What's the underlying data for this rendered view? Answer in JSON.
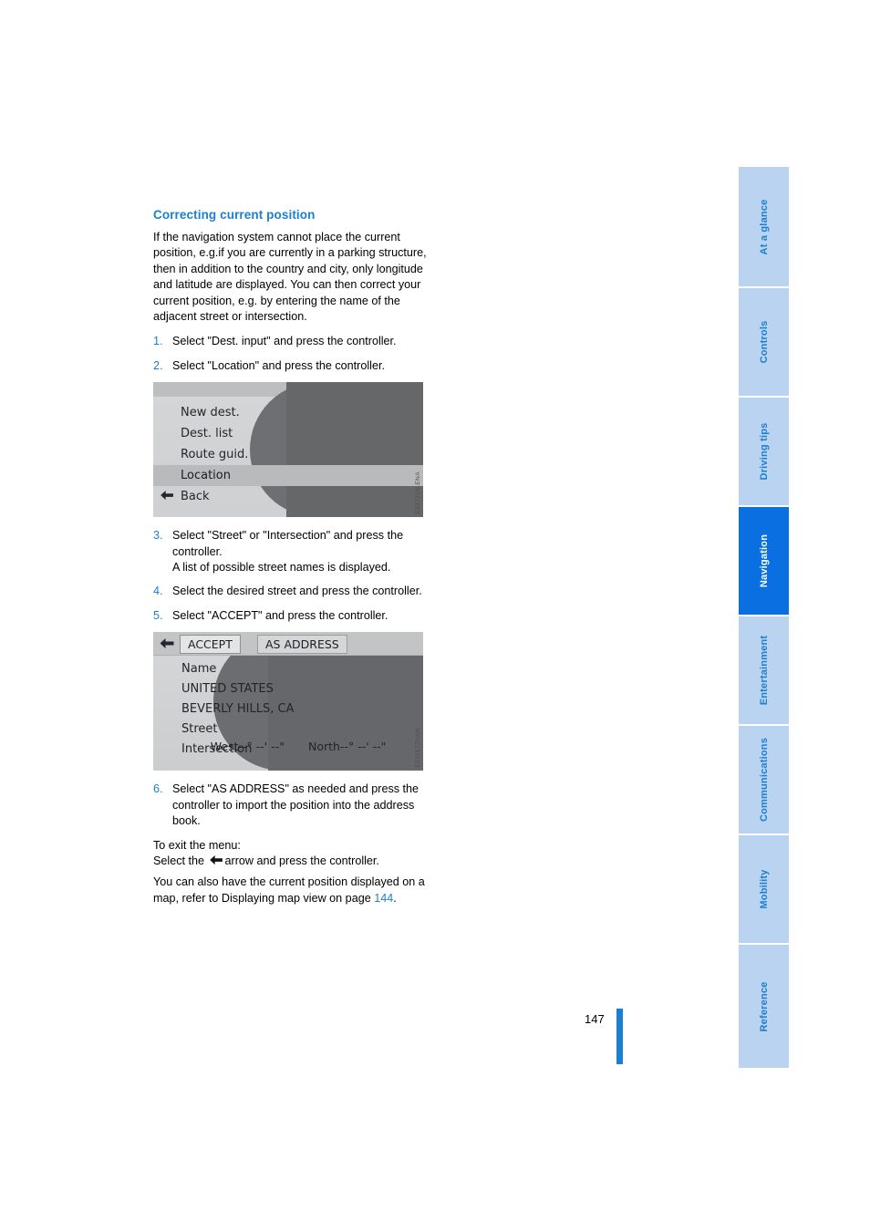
{
  "document": {
    "page_number": "147"
  },
  "main": {
    "heading": "Correcting current position",
    "intro": "If the navigation system cannot place the current position, e.g.if you are currently in a parking structure, then in addition to the country and city, only longitude and latitude are displayed. You can then correct your current position, e.g. by entering the name of the adjacent street or intersection.",
    "steps": [
      {
        "num": "1.",
        "text": "Select \"Dest. input\" and press the controller."
      },
      {
        "num": "2.",
        "text": "Select \"Location\" and press the controller."
      },
      {
        "num": "3.",
        "text": "Select \"Street\" or \"Intersection\" and press the controller.\nA list of possible street names is displayed."
      },
      {
        "num": "4.",
        "text": "Select the desired street and press the controller."
      },
      {
        "num": "5.",
        "text": "Select \"ACCEPT\" and press the controller."
      },
      {
        "num": "6.",
        "text": "Select \"AS ADDRESS\" as needed and press the controller to import the position into the address book."
      }
    ],
    "exit_label": "To exit the menu:",
    "exit_text_before": "Select the",
    "exit_text_after": "arrow and press the controller.",
    "closing_before": "You can also have the current position displayed on a map, refer to Displaying map view on page ",
    "closing_page_link": "144",
    "closing_after": "."
  },
  "screen_one": {
    "items": [
      {
        "label": "New dest.",
        "selected": false
      },
      {
        "label": "Dest. list",
        "selected": false
      },
      {
        "label": "Route guid.",
        "selected": false
      },
      {
        "label": "Location",
        "selected": true
      },
      {
        "label": "Back",
        "selected": false
      }
    ],
    "figure_code": "E52731N.ENA"
  },
  "screen_two": {
    "accept_label": "ACCEPT",
    "as_address_label": "AS ADDRESS",
    "rows": [
      "Name",
      "UNITED STATES",
      "BEVERLY HILLS, CA",
      "Street",
      "Intersection"
    ],
    "coord_west": "West--° --' --\"",
    "coord_north": "North--° --' --\"",
    "figure_code": "E51157ZHAN"
  },
  "rail": {
    "tabs": [
      {
        "label": "At a glance",
        "active": false
      },
      {
        "label": "Controls",
        "active": false
      },
      {
        "label": "Driving tips",
        "active": false
      },
      {
        "label": "Navigation",
        "active": true
      },
      {
        "label": "Entertainment",
        "active": false
      },
      {
        "label": "Communications",
        "active": false
      },
      {
        "label": "Mobility",
        "active": false
      },
      {
        "label": "Reference",
        "active": false
      }
    ]
  },
  "colors": {
    "accent": "#1b7fd4",
    "tab_active": "#0a6fe0",
    "tab_inactive": "#b9d3f0"
  }
}
